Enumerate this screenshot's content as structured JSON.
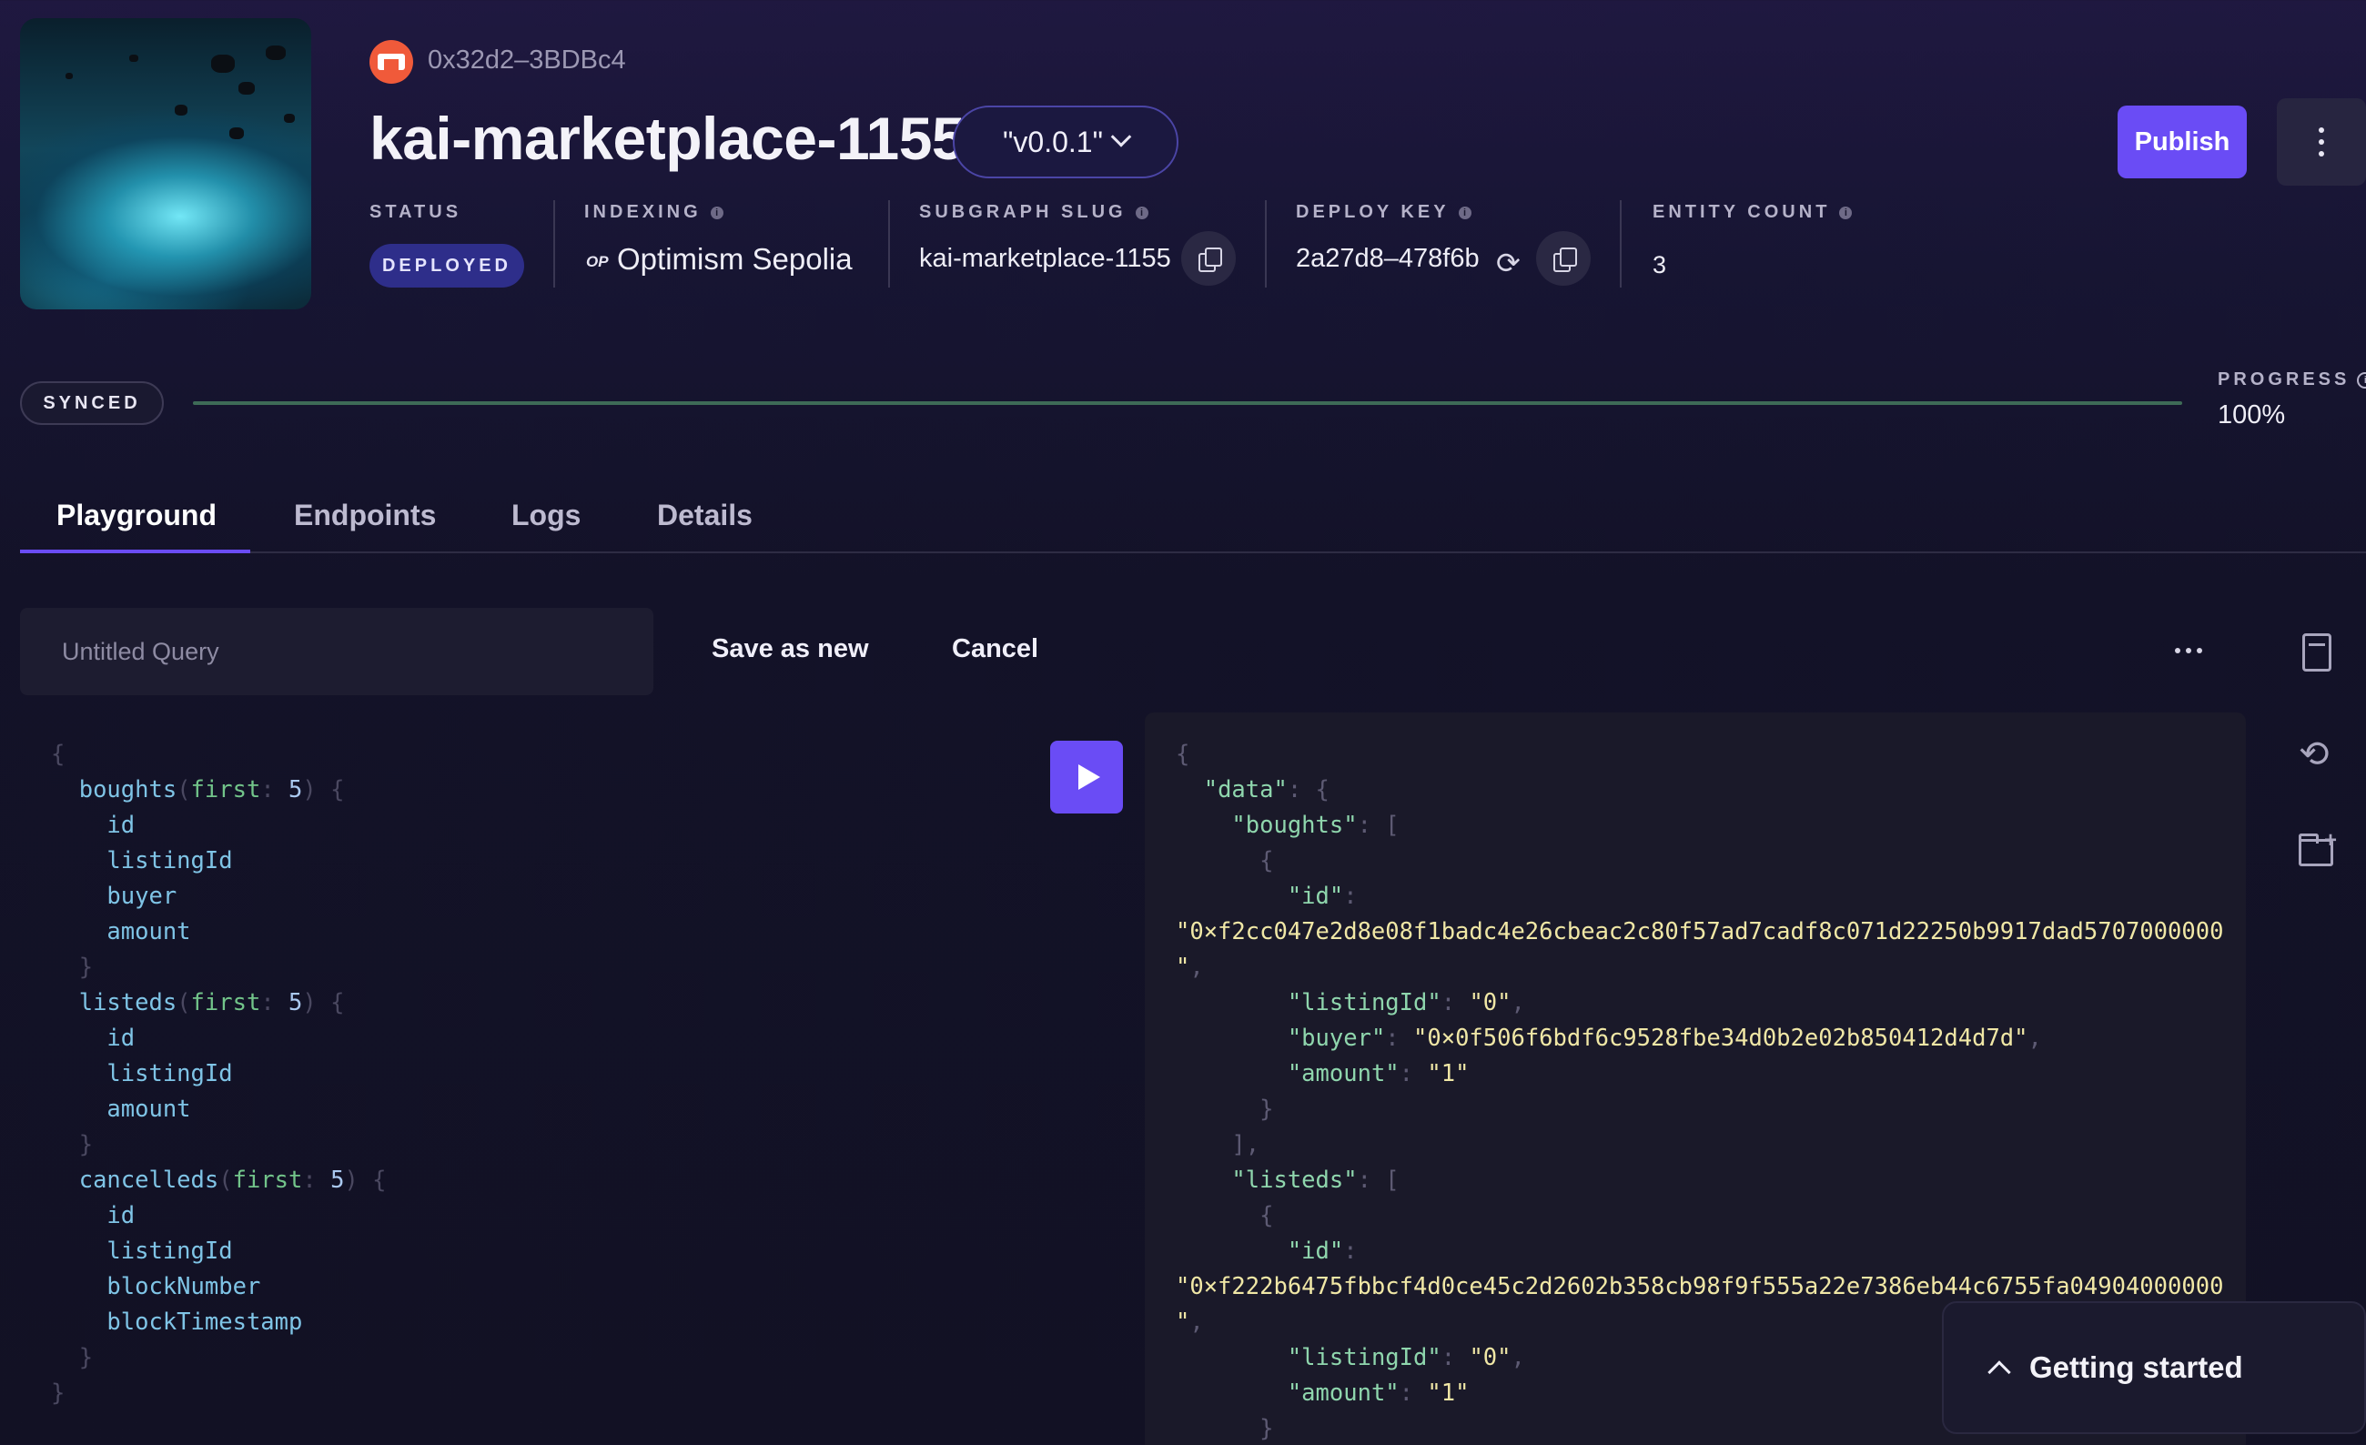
{
  "header": {
    "owner_address": "0x32d2–3BDBc4",
    "subgraph_name": "kai-marketplace-1155",
    "version": "\"v0.0.1\"",
    "publish_label": "Publish",
    "meta": {
      "status_label": "STATUS",
      "status_value": "DEPLOYED",
      "indexing_label": "INDEXING",
      "indexing_logo": "OP",
      "indexing_value": "Optimism Sepolia",
      "slug_label": "SUBGRAPH SLUG",
      "slug_value": "kai-marketplace-1155",
      "deploy_key_label": "DEPLOY KEY",
      "deploy_key_value": "2a27d8–478f6b",
      "entity_count_label": "ENTITY COUNT",
      "entity_count_value": "3"
    },
    "info_glyph": "i"
  },
  "sync": {
    "status": "SYNCED",
    "progress_label": "PROGRESS",
    "progress_value": "100%",
    "progress_fraction": 1.0,
    "info_glyph": "i"
  },
  "tabs": [
    {
      "label": "Playground",
      "active": true
    },
    {
      "label": "Endpoints",
      "active": false
    },
    {
      "label": "Logs",
      "active": false
    },
    {
      "label": "Details",
      "active": false
    }
  ],
  "toolbar": {
    "query_placeholder": "Untitled Query",
    "save_as_new": "Save as new",
    "cancel": "Cancel"
  },
  "editor": {
    "entities": [
      {
        "name": "boughts",
        "arg": "first",
        "value": "5",
        "fields": [
          "id",
          "listingId",
          "buyer",
          "amount"
        ]
      },
      {
        "name": "listeds",
        "arg": "first",
        "value": "5",
        "fields": [
          "id",
          "listingId",
          "amount"
        ]
      },
      {
        "name": "cancelleds",
        "arg": "first",
        "value": "5",
        "fields": [
          "id",
          "listingId",
          "blockNumber",
          "blockTimestamp"
        ]
      }
    ]
  },
  "result": {
    "data_key": "\"data\"",
    "boughts_key": "\"boughts\"",
    "listeds_key": "\"listeds\"",
    "bought_item": {
      "id": "\"0×f2cc047e2d8e08f1badc4e26cbeac2c80f57ad7cadf8c071d22250b9917dad5707000000",
      "id_tail": "\"",
      "listingId": "\"0\"",
      "buyer": "\"0×0f506f6bdf6c9528fbe34d0b2e02b850412d4d7d\"",
      "amount": "\"1\""
    },
    "listed_item": {
      "id": "\"0×f222b6475fbbcf4d0ce45c2d2602b358cb98f9f555a22e7386eb44c6755fa04904000000",
      "id_tail": "\"",
      "listingId": "\"0\"",
      "amount": "\"1\""
    }
  },
  "getting_started": "Getting started",
  "colors": {
    "accent": "#6a4cf5",
    "deployed_badge": "#2e2e8a",
    "background": "#131228"
  },
  "icons": [
    "owner-avatar-icon",
    "chevron-down-icon",
    "more-vertical-icon",
    "info-icon",
    "copy-icon",
    "refresh-icon",
    "more-horizontal-icon",
    "play-icon",
    "document-icon",
    "history-icon",
    "folder-add-icon",
    "chevron-up-icon"
  ]
}
